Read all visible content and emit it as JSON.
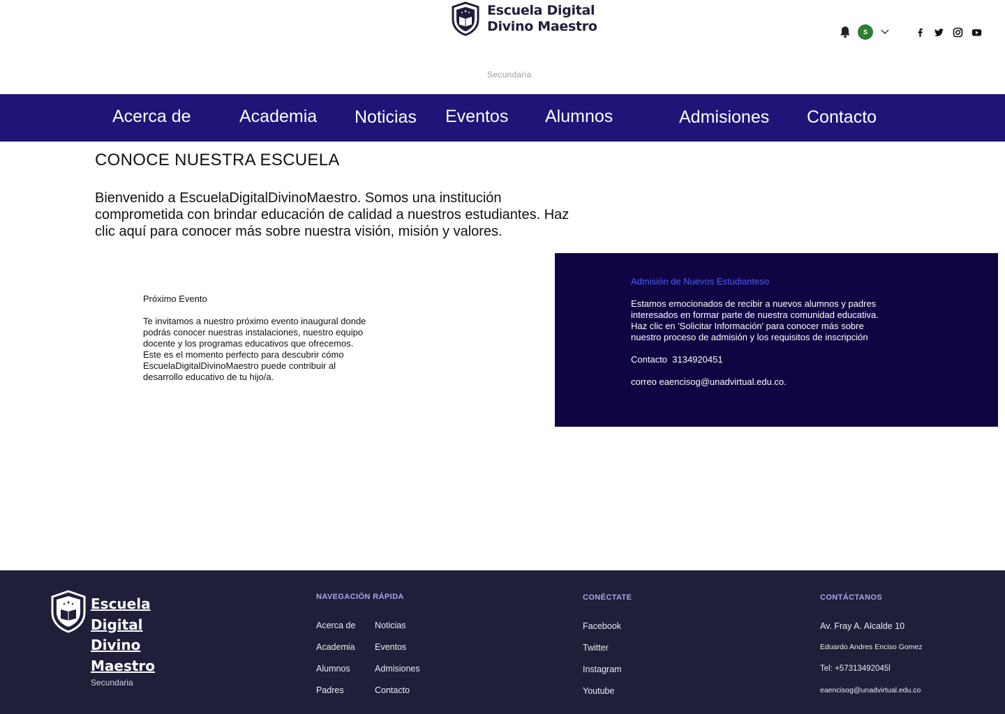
{
  "header": {
    "logo_line1": "Escuela Digital",
    "logo_line2": "Divino Maestro",
    "subtitle": "Secundaria",
    "avatar_initial": "S"
  },
  "nav": {
    "items": [
      "Acerca de",
      "Academia",
      "Noticias",
      "Eventos",
      "Alumnos",
      "Admisiones",
      "Contacto"
    ]
  },
  "main": {
    "title": "CONOCE NUESTRA ESCUELA",
    "intro": "Bienvenido a EscuelaDigitalDivinoMaestro. Somos una institución comprometida con brindar educación de calidad a nuestros estudiantes. Haz clic aquí para conocer más sobre nuestra visión, misión y valores."
  },
  "event": {
    "title": "Próximo Evento",
    "body": "Te invitamos a nuestro próximo evento inaugural donde podrás conocer nuestras instalaciones, nuestro equipo docente y los programas educativos que ofrecemos. Este es el momento perfecto para descubrir cómo EscuelaDigitalDivinoMaestro puede contribuir al desarrollo educativo de tu hijo/a."
  },
  "admission": {
    "title": "Admisión de Nuevos Estudianteso",
    "body": "Estamos emocionados de recibir a nuevos alumnos y padres interesados en formar parte de nuestra comunidad educativa. Haz clic en 'Solicitar Información' para conocer más sobre nuestro proceso de admisión y los requisitos de inscripción",
    "contact": "Contacto  3134920451",
    "email": "correo eaencisog@unadvirtual.edu.co."
  },
  "footer": {
    "name_lines": [
      "Escuela",
      "Digital",
      "Divino",
      "Maestro"
    ],
    "subtitle": "Secundaria",
    "nav_heading": "NAVEGACIÓN RÁPIDA",
    "nav_links": [
      "Acerca de",
      "Noticias",
      "Academia",
      "Eventos",
      "Alumnos",
      "Admisiones",
      "Padres",
      "Contacto"
    ],
    "connect_heading": "CONÉCTATE",
    "connect_links": [
      "Facebook",
      "Twitter",
      "Instagram",
      "Youtube"
    ],
    "contact_heading": "CONTÁCTANOS",
    "contact_lines": [
      "Av. Fray A. Alcalde 10",
      "Eduardo Andres Enciso Gomez",
      "Tel: +57313492045l",
      "eaencisog@unadvirtual.edu.co"
    ]
  },
  "colors": {
    "nav_bg": "#1f1478",
    "admission_bg": "#0f0543",
    "footer_bg": "#1f1f3a",
    "admission_title": "#4a5cff",
    "avatar_bg": "#2e7d32"
  },
  "icons": [
    "shield-book-logo",
    "bell-icon",
    "chevron-down-icon",
    "facebook-icon",
    "twitter-icon",
    "instagram-icon",
    "youtube-icon"
  ]
}
